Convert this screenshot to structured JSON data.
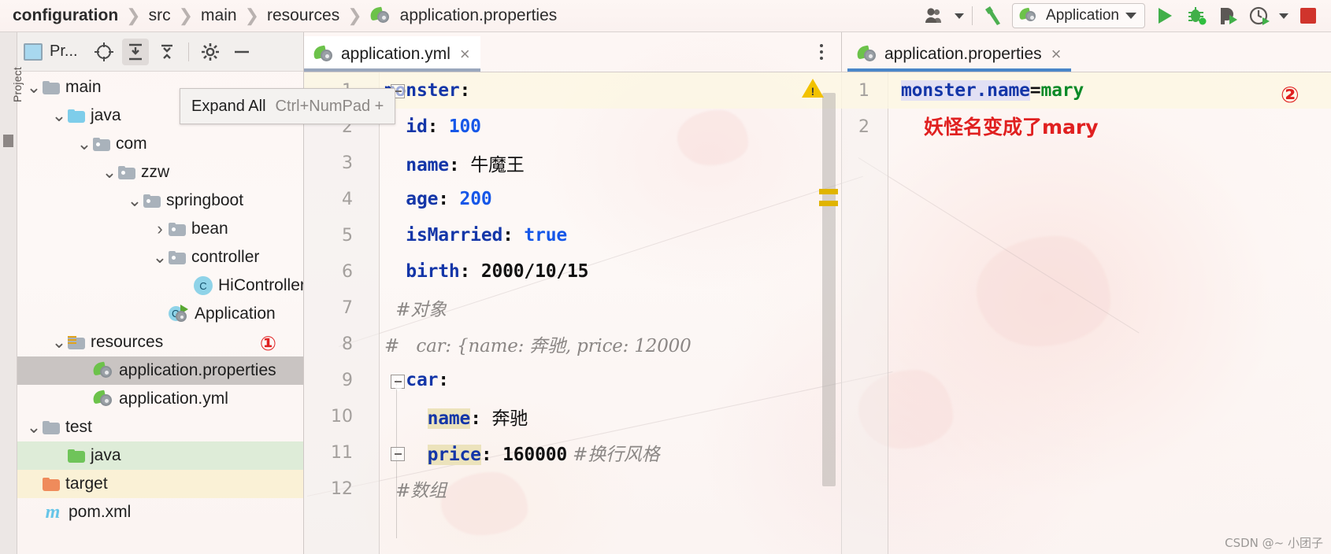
{
  "toolbar": {
    "breadcrumbs": [
      "configuration",
      "src",
      "main",
      "resources",
      "application.properties"
    ],
    "run_config": "Application",
    "icons": {
      "user_icon": "user-group-icon",
      "build_icon": "build-hammer-icon",
      "run_icon": "run-play-icon",
      "debug_icon": "debug-bug-icon",
      "run_coverage_icon": "run-with-coverage-icon",
      "profiler_icon": "profiler-icon",
      "stop_icon": "stop-square-icon"
    }
  },
  "sidebar": {
    "strip_label": "Project",
    "panel_title": "Pr...",
    "header_buttons": [
      "locate-icon",
      "expand-all-icon",
      "collapse-all-icon",
      "settings-gear-icon",
      "hide-minus-icon"
    ],
    "tooltip": {
      "label": "Expand All",
      "shortcut": "Ctrl+NumPad +"
    },
    "tree": [
      {
        "label": "main",
        "indent": 0,
        "twist": "v",
        "icon": "folder",
        "state": ""
      },
      {
        "label": "java",
        "indent": 1,
        "twist": "v",
        "icon": "folder-source",
        "state": ""
      },
      {
        "label": "com",
        "indent": 2,
        "twist": "v",
        "icon": "folder-pkg",
        "state": ""
      },
      {
        "label": "zzw",
        "indent": 3,
        "twist": "v",
        "icon": "folder-pkg",
        "state": ""
      },
      {
        "label": "springboot",
        "indent": 4,
        "twist": "v",
        "icon": "folder-pkg",
        "state": ""
      },
      {
        "label": "bean",
        "indent": 5,
        "twist": ">",
        "icon": "folder-pkg",
        "state": ""
      },
      {
        "label": "controller",
        "indent": 5,
        "twist": "v",
        "icon": "folder-pkg",
        "state": ""
      },
      {
        "label": "HiController",
        "indent": 6,
        "twist": "",
        "icon": "java-class",
        "state": ""
      },
      {
        "label": "Application",
        "indent": 5,
        "twist": "",
        "icon": "spring-app",
        "state": ""
      },
      {
        "label": "resources",
        "indent": 1,
        "twist": "v",
        "icon": "folder-res",
        "state": "",
        "badge": "①"
      },
      {
        "label": "application.properties",
        "indent": 2,
        "twist": "",
        "icon": "spring-file",
        "state": "sel"
      },
      {
        "label": "application.yml",
        "indent": 2,
        "twist": "",
        "icon": "spring-file",
        "state": ""
      },
      {
        "label": "test",
        "indent": 0,
        "twist": "v",
        "icon": "folder",
        "state": ""
      },
      {
        "label": "java",
        "indent": 1,
        "twist": "",
        "icon": "folder-test",
        "state": "green"
      },
      {
        "label": "target",
        "indent": 0,
        "twist": "",
        "icon": "folder-target",
        "state": "amber"
      },
      {
        "label": "pom.xml",
        "indent": 0,
        "twist": "",
        "icon": "maven",
        "state": ""
      }
    ]
  },
  "editor_left": {
    "tab": {
      "label": "application.yml",
      "close": "×"
    },
    "lines": [
      {
        "no": "1",
        "highlight": true,
        "tokens": [
          {
            "t": "monster",
            "c": "k"
          },
          {
            "t": ":",
            "c": "plain"
          }
        ]
      },
      {
        "no": "2",
        "highlight": false,
        "tokens": [
          {
            "t": "  id",
            "c": "k"
          },
          {
            "t": ": ",
            "c": "plain"
          },
          {
            "t": "100",
            "c": "v"
          }
        ]
      },
      {
        "no": "3",
        "highlight": false,
        "tokens": [
          {
            "t": "  name",
            "c": "k"
          },
          {
            "t": ": ",
            "c": "plain"
          },
          {
            "t": "牛魔王",
            "c": "cjk"
          }
        ]
      },
      {
        "no": "4",
        "highlight": false,
        "tokens": [
          {
            "t": "  age",
            "c": "k"
          },
          {
            "t": ": ",
            "c": "plain"
          },
          {
            "t": "200",
            "c": "v"
          }
        ]
      },
      {
        "no": "5",
        "highlight": false,
        "tokens": [
          {
            "t": "  isMarried",
            "c": "k"
          },
          {
            "t": ": ",
            "c": "plain"
          },
          {
            "t": "true",
            "c": "v"
          }
        ]
      },
      {
        "no": "6",
        "highlight": false,
        "tokens": [
          {
            "t": "  birth",
            "c": "k"
          },
          {
            "t": ": ",
            "c": "plain"
          },
          {
            "t": "2000/10/15",
            "c": "plain"
          }
        ]
      },
      {
        "no": "7",
        "highlight": false,
        "tokens": [
          {
            "t": "  #对象",
            "c": "cm"
          }
        ]
      },
      {
        "no": "8",
        "highlight": false,
        "tokens": [
          {
            "t": "#   car: {name: 奔驰, price: 12000",
            "c": "cm"
          }
        ]
      },
      {
        "no": "9",
        "highlight": false,
        "tokens": [
          {
            "t": "  car",
            "c": "k"
          },
          {
            "t": ":",
            "c": "plain"
          }
        ]
      },
      {
        "no": "10",
        "highlight": false,
        "tokens": [
          {
            "t": "    ",
            "c": "plain"
          },
          {
            "t": "name",
            "c": "k idhl"
          },
          {
            "t": ": ",
            "c": "plain"
          },
          {
            "t": "奔驰",
            "c": "cjk"
          }
        ]
      },
      {
        "no": "11",
        "highlight": false,
        "tokens": [
          {
            "t": "    ",
            "c": "plain"
          },
          {
            "t": "price",
            "c": "k idhl"
          },
          {
            "t": ": ",
            "c": "plain"
          },
          {
            "t": "160000",
            "c": "plain"
          },
          {
            "t": " #换行风格",
            "c": "cm"
          }
        ]
      },
      {
        "no": "12",
        "highlight": false,
        "tokens": [
          {
            "t": "  #数组",
            "c": "cm"
          }
        ]
      }
    ]
  },
  "editor_right": {
    "tab": {
      "label": "application.properties",
      "close": "×"
    },
    "lines": [
      {
        "no": "1",
        "highlight": true,
        "tokens": [
          {
            "t": "monster.name",
            "c": "propkey"
          },
          {
            "t": "=",
            "c": "eq"
          },
          {
            "t": "mary",
            "c": "green-val"
          }
        ]
      },
      {
        "no": "2",
        "highlight": false,
        "tokens": []
      }
    ],
    "annotation_text": "妖怪名变成了mary",
    "annotation_badge": "②",
    "warning_icon": "warning-triangle-icon"
  },
  "watermark": "CSDN @~ 小团子",
  "colors": {
    "yaml_key": "#1436a8",
    "yaml_value": "#1657e8",
    "comment": "#8b8785",
    "prop_value": "#0b8a27",
    "annotation_red": "#e02020",
    "active_tab_underline": "#4a86c8",
    "selection_gray": "#c9c4c2"
  }
}
